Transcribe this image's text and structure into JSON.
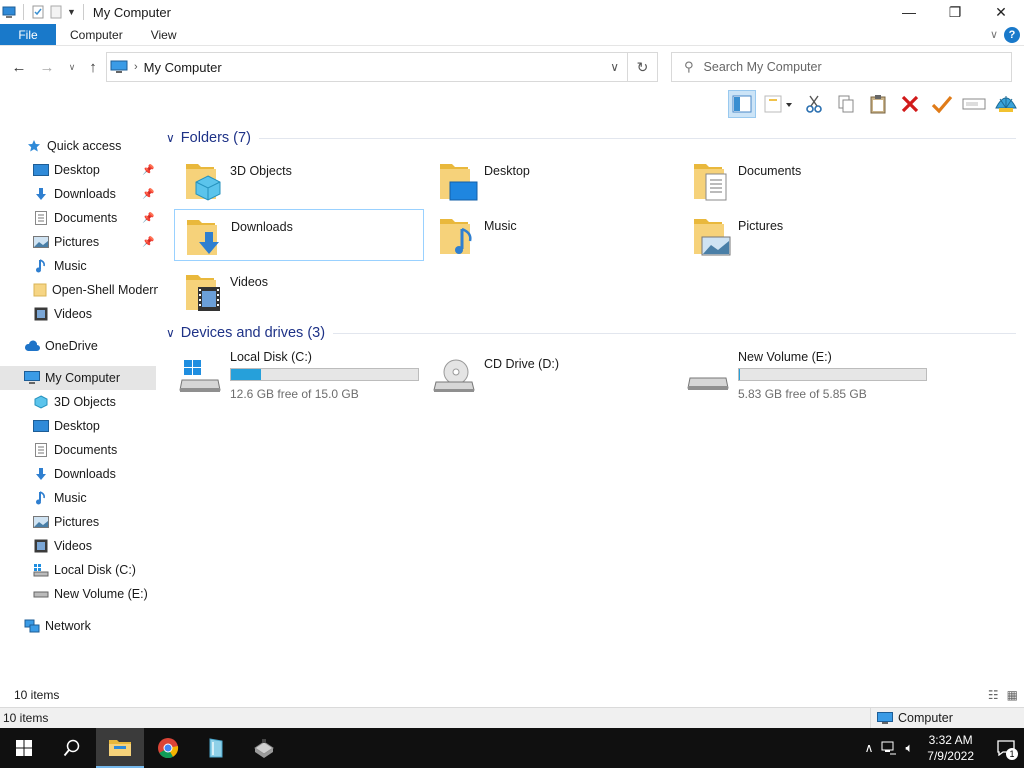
{
  "window": {
    "title": "My Computer",
    "minimize": "—",
    "maximize": "❐",
    "close": "✕"
  },
  "ribbon": {
    "tabs": [
      {
        "label": "File"
      },
      {
        "label": "Computer"
      },
      {
        "label": "View"
      }
    ],
    "help": "?"
  },
  "address": {
    "path": "My Computer",
    "search_placeholder": "Search My Computer"
  },
  "nav_pane": {
    "items": [
      {
        "label": "Quick access",
        "icon": "star-icon",
        "pinned": false
      },
      {
        "label": "Desktop",
        "icon": "desktop-icon",
        "pinned": true
      },
      {
        "label": "Downloads",
        "icon": "download-icon",
        "pinned": true
      },
      {
        "label": "Documents",
        "icon": "document-icon",
        "pinned": true
      },
      {
        "label": "Pictures",
        "icon": "pictures-icon",
        "pinned": true
      },
      {
        "label": "Music",
        "icon": "music-icon",
        "pinned": false
      },
      {
        "label": "Open-Shell Modern",
        "icon": "folder-icon",
        "pinned": false
      },
      {
        "label": "Videos",
        "icon": "video-icon",
        "pinned": false
      },
      {
        "label": "OneDrive",
        "icon": "cloud-icon",
        "pinned": false
      },
      {
        "label": "My Computer",
        "icon": "computer-icon",
        "pinned": false,
        "selected": true
      },
      {
        "label": "3D Objects",
        "icon": "cube-icon",
        "pinned": false
      },
      {
        "label": "Desktop",
        "icon": "desktop-icon",
        "pinned": false
      },
      {
        "label": "Documents",
        "icon": "document-icon",
        "pinned": false
      },
      {
        "label": "Downloads",
        "icon": "download-icon",
        "pinned": false
      },
      {
        "label": "Music",
        "icon": "music-icon",
        "pinned": false
      },
      {
        "label": "Pictures",
        "icon": "pictures-icon",
        "pinned": false
      },
      {
        "label": "Videos",
        "icon": "video-icon",
        "pinned": false
      },
      {
        "label": "Local Disk (C:)",
        "icon": "windows-drive-icon",
        "pinned": false
      },
      {
        "label": "New Volume (E:)",
        "icon": "drive-icon",
        "pinned": false
      },
      {
        "label": "Network",
        "icon": "network-icon",
        "pinned": false
      }
    ]
  },
  "folders": {
    "header": "Folders (7)",
    "items": [
      {
        "name": "3D Objects",
        "overlay": "cube"
      },
      {
        "name": "Desktop",
        "overlay": "desktop"
      },
      {
        "name": "Documents",
        "overlay": "document"
      },
      {
        "name": "Downloads",
        "overlay": "download"
      },
      {
        "name": "Music",
        "overlay": "music"
      },
      {
        "name": "Pictures",
        "overlay": "picture"
      },
      {
        "name": "Videos",
        "overlay": "video"
      }
    ]
  },
  "drives": {
    "header": "Devices and drives (3)",
    "items": [
      {
        "name": "Local Disk (C:)",
        "free": "12.6 GB free of 15.0 GB",
        "used_fraction": 0.16,
        "type": "windows-disk"
      },
      {
        "name": "CD Drive (D:)",
        "free": "",
        "type": "cd"
      },
      {
        "name": "New Volume (E:)",
        "free": "5.83 GB free of 5.85 GB",
        "used_fraction": 0.003,
        "type": "disk"
      }
    ]
  },
  "status": {
    "item_count": "10 items",
    "bottom_count": "10 items",
    "zone": "Computer"
  },
  "taskbar": {
    "time": "3:32 AM",
    "date": "7/9/2022",
    "notifications": "1"
  },
  "colors": {
    "accent": "#1979ca",
    "group_header": "#1e3287",
    "drive_bar": "#26a0da",
    "folder": "#f0c24b"
  }
}
